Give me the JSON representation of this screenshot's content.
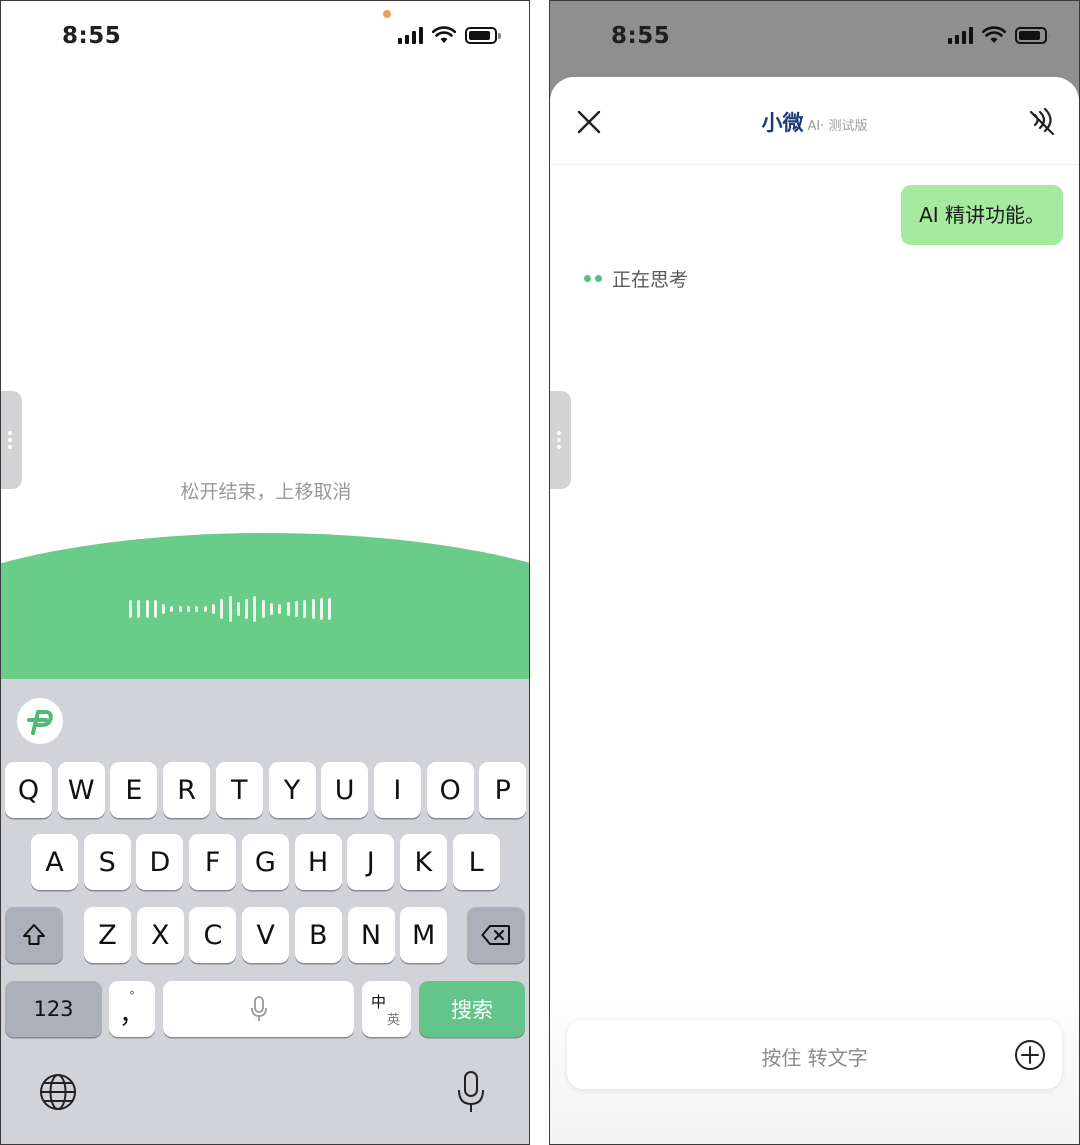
{
  "left": {
    "status_time": "8:55",
    "hint": "松开结束，上移取消",
    "keyboard": {
      "row1": [
        "Q",
        "W",
        "E",
        "R",
        "T",
        "Y",
        "U",
        "I",
        "O",
        "P"
      ],
      "row2": [
        "A",
        "S",
        "D",
        "F",
        "G",
        "H",
        "J",
        "K",
        "L"
      ],
      "row3": [
        "Z",
        "X",
        "C",
        "V",
        "B",
        "N",
        "M"
      ],
      "numbers_label": "123",
      "punct_top": "°",
      "punct_main": "，",
      "lang_top": "中",
      "lang_bottom": "英",
      "search_label": "搜索"
    }
  },
  "right": {
    "status_time": "8:55",
    "header": {
      "title": "小微",
      "subtitle": "AI· 测试版"
    },
    "messages": [
      {
        "role": "user",
        "text": "AI 精讲功能。"
      }
    ],
    "thinking_label": "正在思考",
    "input_placeholder": "按住 转文字"
  },
  "colors": {
    "accent_green": "#6acc89",
    "user_bubble": "#a6ea9f",
    "title_blue": "#1d3a7a"
  }
}
